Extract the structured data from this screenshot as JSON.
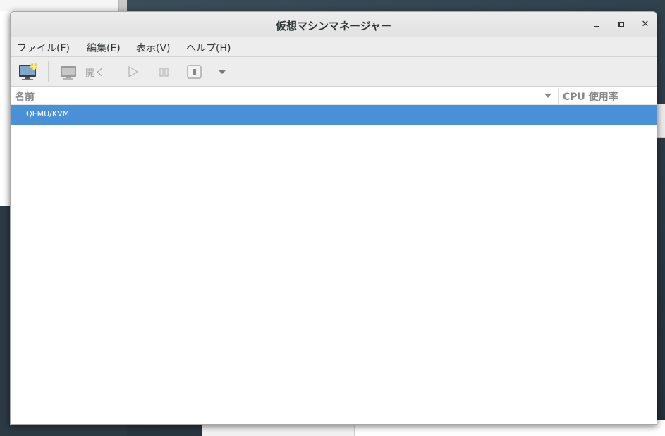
{
  "window": {
    "title": "仮想マシンマネージャー",
    "minimize_icon": "minimize-icon",
    "maximize_icon": "maximize-icon",
    "close_icon": "close-icon",
    "close_glyph": "✕"
  },
  "menubar": {
    "items": [
      {
        "label": "ファイル(F)"
      },
      {
        "label": "編集(E)"
      },
      {
        "label": "表示(V)"
      },
      {
        "label": "ヘルプ(H)"
      }
    ]
  },
  "toolbar": {
    "new_vm_icon": "new-vm-icon",
    "open_icon": "monitor-icon",
    "open_label": "開く",
    "run_icon": "play-icon",
    "pause_icon": "pause-icon",
    "shutdown_icon": "shutdown-icon",
    "shutdown_menu_icon": "chevron-down-icon"
  },
  "columns": {
    "name": "名前",
    "cpu": "CPU 使用率"
  },
  "connections": [
    {
      "name": "QEMU/KVM",
      "selected": true
    }
  ],
  "colors": {
    "selection": "#4a90d9",
    "header_text": "#8a8a8a",
    "disabled_text": "#a0a0a0"
  }
}
